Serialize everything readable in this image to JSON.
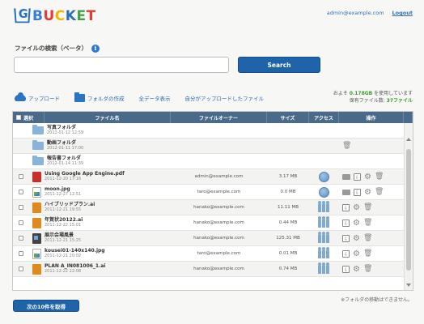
{
  "brand": {
    "logo_mark": "G",
    "logo_letters": [
      {
        "ch": "B",
        "color": "#3a7bd5"
      },
      {
        "ch": "U",
        "color": "#e53935"
      },
      {
        "ch": "C",
        "color": "#f4b400"
      },
      {
        "ch": "K",
        "color": "#2a6fb7"
      },
      {
        "ch": "E",
        "color": "#43a047"
      },
      {
        "ch": "T",
        "color": "#e53935"
      }
    ]
  },
  "header": {
    "user_email": "admin@example.com",
    "logout_label": "Logout"
  },
  "search": {
    "label": "ファイルの検索（ベータ）",
    "info_icon": "i",
    "placeholder": "",
    "button_label": "Search"
  },
  "actions": {
    "upload": "アップロード",
    "create_folder": "フォルダの作成",
    "show_all": "全データ表示",
    "my_uploads": "自分がアップロードしたファイル"
  },
  "usage": {
    "line1_prefix": "およそ",
    "used": "0.178GB",
    "line1_suffix": "を使用しています",
    "line2_prefix": "保有ファイル数:",
    "file_count": "37ファイル"
  },
  "table": {
    "headers": {
      "select": "選択",
      "name": "ファイル名",
      "owner": "ファイルオーナー",
      "size": "サイズ",
      "access": "アクセス",
      "ops": "操作"
    },
    "rows": [
      {
        "type": "folder",
        "name": "写真フォルダ",
        "date": "2012-01-12 12:59",
        "owner": "",
        "size": "",
        "access": "",
        "checkbox": false,
        "ops": []
      },
      {
        "type": "folder",
        "name": "動画フォルダ",
        "date": "2012-01-11 17:00",
        "owner": "",
        "size": "",
        "access": "",
        "checkbox": false,
        "ops": [
          "trash"
        ]
      },
      {
        "type": "folder",
        "name": "報告書フォルダ",
        "date": "2012-01-14 11:39",
        "owner": "",
        "size": "",
        "access": "",
        "checkbox": false,
        "ops": []
      },
      {
        "type": "pdf",
        "name": "Using Google App Engine.pdf",
        "date": "2011-12-20 17:16",
        "owner": "admin@example.com",
        "size": "3.17 MB",
        "access": "globe",
        "checkbox": true,
        "ops": [
          "mail",
          "download",
          "gear",
          "trash"
        ]
      },
      {
        "type": "img",
        "name": "moon.jpg",
        "date": "2011-12-27 12:51",
        "owner": "taro@example.com",
        "size": "0.0 MB",
        "access": "globe",
        "checkbox": true,
        "ops": [
          "mail",
          "download",
          "gear",
          "trash"
        ]
      },
      {
        "type": "ai",
        "name": "ハイブリッドプラン.ai",
        "date": "2011-12-21 19:55",
        "owner": "hanako@example.com",
        "size": "11.11 MB",
        "access": "people",
        "checkbox": true,
        "ops": [
          "download",
          "gear",
          "trash"
        ]
      },
      {
        "type": "ai",
        "name": "年賀状20122.ai",
        "date": "2011-12-22 15:01",
        "owner": "hanako@example.com",
        "size": "0.44 MB",
        "access": "people",
        "checkbox": true,
        "ops": [
          "download",
          "gear",
          "trash"
        ]
      },
      {
        "type": "mov",
        "name": "展示会場風景",
        "date": "2011-12-21 15:25",
        "owner": "hanako@example.com",
        "size": "125.31 MB",
        "access": "people",
        "checkbox": true,
        "ops": [
          "download",
          "gear",
          "trash"
        ]
      },
      {
        "type": "img",
        "name": "kousei01-140x140.jpg",
        "date": "2011-12-21 20:02",
        "owner": "taro@example.com",
        "size": "0.01 MB",
        "access": "people",
        "checkbox": true,
        "ops": [
          "download",
          "gear",
          "trash"
        ]
      },
      {
        "type": "ai",
        "name": "PLAN A_IN081006_1.ai",
        "date": "2011-12-22 22:08",
        "owner": "hanako@example.com",
        "size": "0.74 MB",
        "access": "people",
        "checkbox": true,
        "ops": [
          "download",
          "gear",
          "trash"
        ]
      }
    ]
  },
  "footer": {
    "note": "※フォルダの移動はできません。",
    "next_button": "次の10件を取得"
  }
}
